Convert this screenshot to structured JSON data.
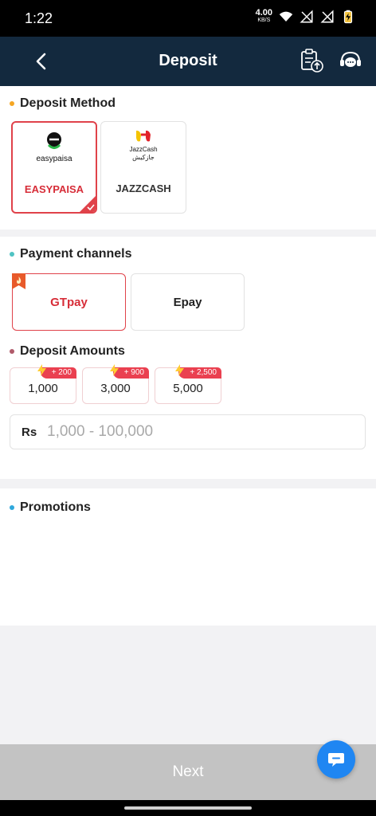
{
  "status_bar": {
    "time": "1:22",
    "net_speed_value": "4.00",
    "net_speed_unit": "KB/S",
    "icons": [
      "wifi-icon",
      "signal-off-icon",
      "signal-off-icon",
      "battery-charging-icon"
    ]
  },
  "header": {
    "title": "Deposit",
    "icons": [
      "back-arrow-icon",
      "deposit-record-icon",
      "customer-service-icon"
    ]
  },
  "deposit_method": {
    "title": "Deposit Method",
    "dot_color": "#f5a623",
    "methods": [
      {
        "name": "EASYPAISA",
        "logo_text": "easypaisa",
        "selected": true
      },
      {
        "name": "JAZZCASH",
        "logo_text": "JazzCash",
        "logo_subtext": "جازکیش",
        "selected": false
      }
    ]
  },
  "payment_channels": {
    "title": "Payment channels",
    "dot_color": "#4fc3c3",
    "channels": [
      {
        "name": "GTpay",
        "selected": true,
        "badge": "hot-badge-icon"
      },
      {
        "name": "Epay",
        "selected": false
      }
    ]
  },
  "deposit_amounts": {
    "title": "Deposit Amounts",
    "dot_color": "#b05a6a",
    "amounts": [
      {
        "value": "1,000",
        "bonus": "+ 200"
      },
      {
        "value": "3,000",
        "bonus": "+ 900"
      },
      {
        "value": "5,000",
        "bonus": "+ 2,500"
      }
    ],
    "currency": "Rs",
    "input_placeholder": "1,000 - 100,000",
    "input_value": ""
  },
  "promotions": {
    "title": "Promotions",
    "dot_color": "#2fa8dc"
  },
  "footer": {
    "next_label": "Next"
  },
  "colors": {
    "header_bg": "#13293e",
    "accent_red": "#e0424a",
    "next_disabled": "#c3c3c3",
    "fab_blue": "#1f86f2"
  }
}
